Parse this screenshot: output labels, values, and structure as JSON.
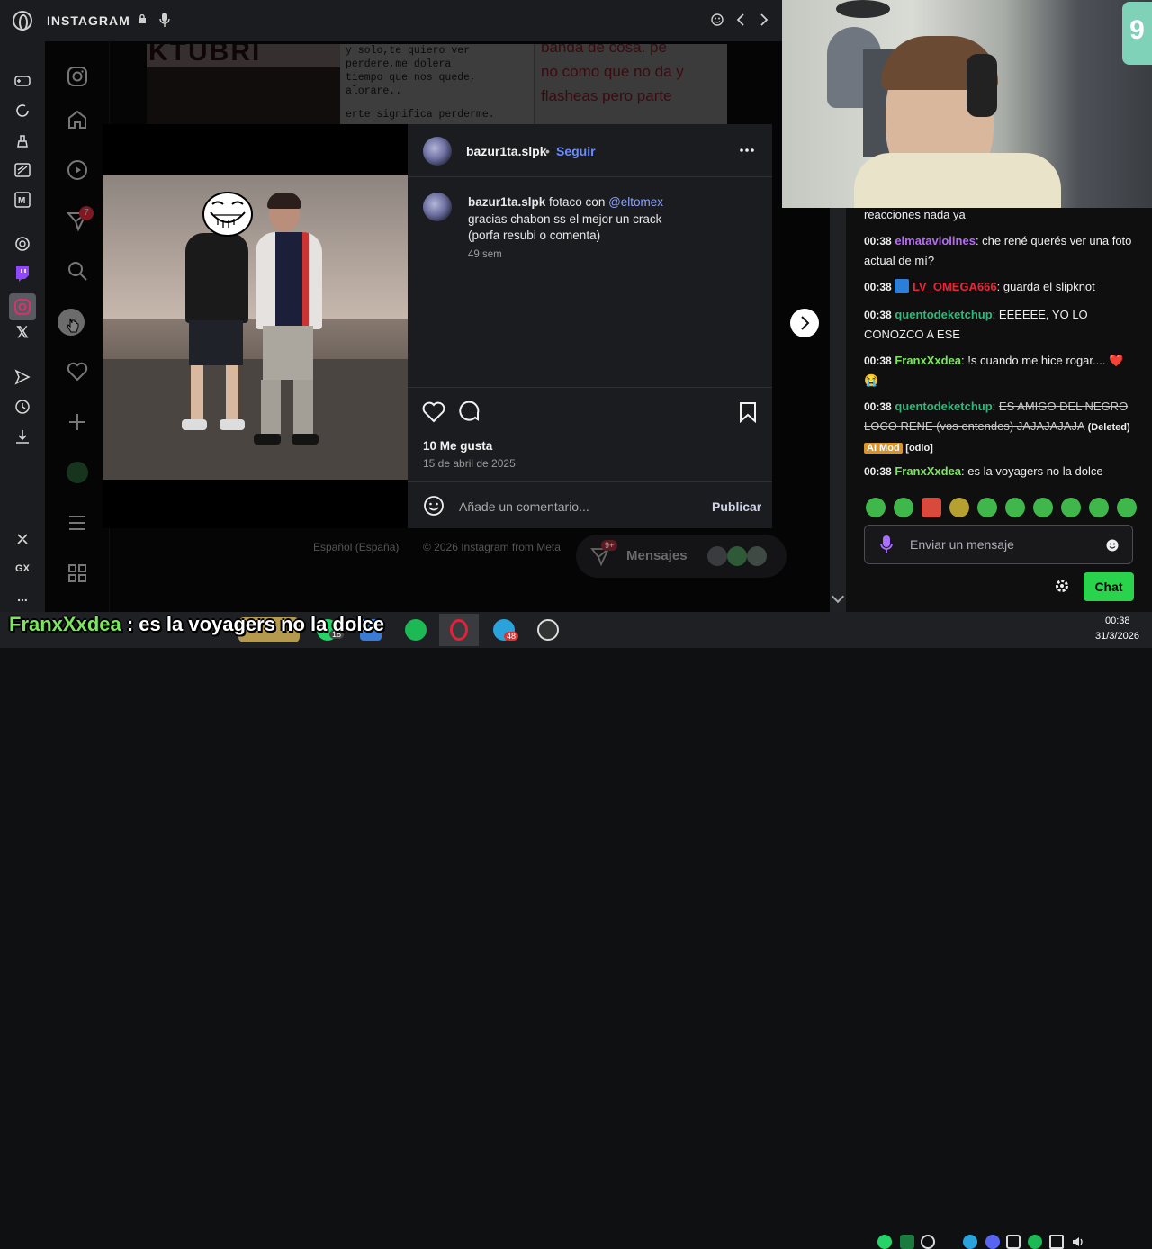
{
  "browser": {
    "tab_title": "INSTAGRAM"
  },
  "opera_sidebar": {
    "labels": {
      "gx": "GX",
      "more": "..."
    }
  },
  "instagram": {
    "nav": {
      "notification_count": "7"
    },
    "background_post": {
      "text_lines": [
        "y solo,te quiero ver",
        "perdere,me dolera",
        "tiempo que nos quede,",
        "alorare..",
        "erte significa perderme."
      ],
      "right_text": [
        "banda de cosa. pe",
        "no como que no da y",
        "flasheas pero parte"
      ],
      "banner": "KTUBRI"
    },
    "post": {
      "username": "bazur1ta.slpk",
      "separator": "•",
      "follow_label": "Seguir",
      "caption_username": "bazur1ta.slpk",
      "caption_text_1": " fotaco con ",
      "caption_mention": "@eltomex",
      "caption_text_2": "gracias chabon ss el mejor un crack",
      "caption_text_3": "(porfa resubi o comenta)",
      "caption_time": "49 sem",
      "likes": "10 Me gusta",
      "date": "15 de abril de 2025",
      "comment_placeholder": "Añade un comentario...",
      "publish_label": "Publicar"
    },
    "footer": {
      "language": "Español (España)",
      "copyright": "© 2026 Instagram from Meta"
    },
    "messages": {
      "label": "Mensajes",
      "badge": "9+"
    }
  },
  "webcam": {
    "corner_number": "9"
  },
  "chat": {
    "messages": [
      {
        "text": "reacciones nada ya"
      },
      {
        "time": "00:38",
        "user": "elmataviolines",
        "user_color": "#b56cf0",
        "text": "che rené querés ver una foto actual de mí?"
      },
      {
        "time": "00:38",
        "user": "LV_OMEGA666",
        "user_color": "#e5273a",
        "text": "guarda el slipknot"
      },
      {
        "time": "00:38",
        "user": "quentodeketchup",
        "user_color": "#2fb87a",
        "text": "EEEEEE, YO LO CONOZCO A ESE"
      },
      {
        "time": "00:38",
        "user": "FranxXxdea",
        "user_color": "#7ce65d",
        "text": "!s cuando me hice rogar.... ❤️😭"
      },
      {
        "time": "00:38",
        "user": "quentodeketchup",
        "user_color": "#2fb87a",
        "text": "ES AMIGO DEL NEGRO LOCO RENE (vos entendes) JAJAJAJAJA",
        "deleted_tag": "(Deleted)",
        "aimod_tag": "AI Mod",
        "reason_tag": "[odio]"
      },
      {
        "time": "00:38",
        "user": "FranxXxdea",
        "user_color": "#7ce65d",
        "text": "es la voyagers no la dolce"
      }
    ],
    "input_placeholder": "Enviar un mensaje",
    "chat_button": "Chat"
  },
  "overlay": {
    "user": "FranxXxdea",
    "text": " : es la voyagers no la dolce"
  },
  "taskbar": {
    "clock_time": "00:38",
    "clock_date": "31/3/2026",
    "badge_telegram": "48",
    "badge_whatsapp": "18"
  }
}
